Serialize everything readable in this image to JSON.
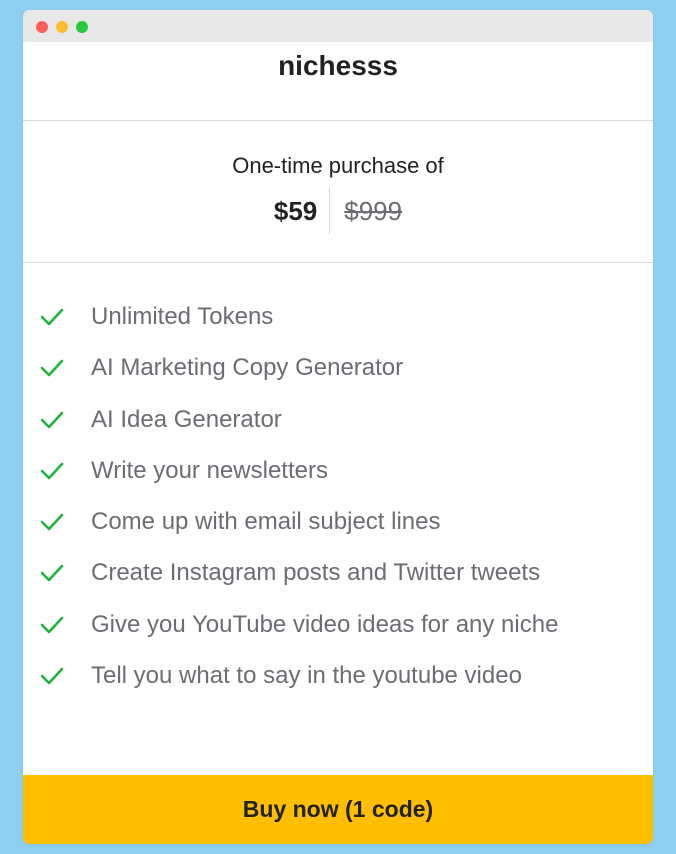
{
  "window": {
    "controls": [
      "close-dot",
      "minimize-dot",
      "zoom-dot"
    ]
  },
  "product": {
    "name": "nichesss"
  },
  "pricing": {
    "label": "One-time purchase of",
    "price": "$59",
    "original_price": "$999"
  },
  "features": [
    "Unlimited Tokens",
    "AI Marketing Copy Generator",
    "AI Idea Generator",
    "Write your newsletters",
    "Come up with email subject lines",
    "Create Instagram posts and Twitter tweets",
    "Give you YouTube video ideas for any niche",
    "Tell you what to say in the youtube video"
  ],
  "buy_button": {
    "label": "Buy now (1 code)"
  },
  "colors": {
    "background": "#8ecff0",
    "accent": "#ffbe00",
    "check": "#1fb33e",
    "close": "#fe5f57",
    "minimize": "#febc2e",
    "zoom": "#28c840"
  },
  "icons": {
    "feature_check": "check-icon"
  }
}
